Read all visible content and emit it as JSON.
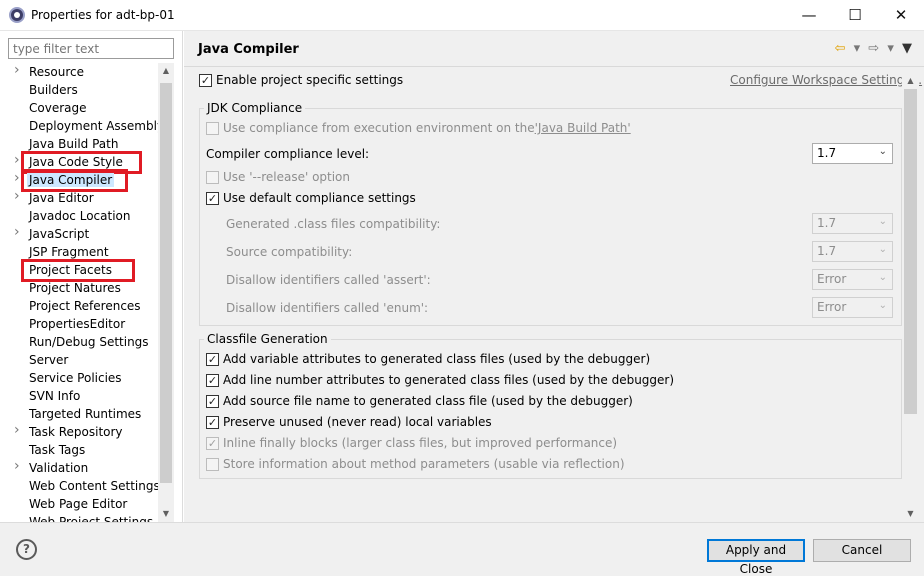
{
  "window": {
    "title": "Properties for adt-bp-01",
    "minimize_icon": "minimize-icon",
    "maximize_icon": "maximize-icon",
    "close_icon": "close-icon"
  },
  "filter": {
    "placeholder": "type filter text"
  },
  "tree": {
    "items": [
      {
        "label": "Resource",
        "expandable": true
      },
      {
        "label": "Builders",
        "expandable": false
      },
      {
        "label": "Coverage",
        "expandable": false
      },
      {
        "label": "Deployment Assembly",
        "expandable": false
      },
      {
        "label": "Java Build Path",
        "expandable": false
      },
      {
        "label": "Java Code Style",
        "expandable": true,
        "highlighted": true
      },
      {
        "label": "Java Compiler",
        "expandable": true,
        "highlighted": true,
        "selected": true
      },
      {
        "label": "Java Editor",
        "expandable": true
      },
      {
        "label": "Javadoc Location",
        "expandable": false
      },
      {
        "label": "JavaScript",
        "expandable": true
      },
      {
        "label": "JSP Fragment",
        "expandable": false
      },
      {
        "label": "Project Facets",
        "expandable": false,
        "highlighted": true
      },
      {
        "label": "Project Natures",
        "expandable": false
      },
      {
        "label": "Project References",
        "expandable": false
      },
      {
        "label": "PropertiesEditor",
        "expandable": false
      },
      {
        "label": "Run/Debug Settings",
        "expandable": false
      },
      {
        "label": "Server",
        "expandable": false
      },
      {
        "label": "Service Policies",
        "expandable": false
      },
      {
        "label": "SVN Info",
        "expandable": false
      },
      {
        "label": "Targeted Runtimes",
        "expandable": false
      },
      {
        "label": "Task Repository",
        "expandable": true
      },
      {
        "label": "Task Tags",
        "expandable": false
      },
      {
        "label": "Validation",
        "expandable": true
      },
      {
        "label": "Web Content Settings",
        "expandable": false
      },
      {
        "label": "Web Page Editor",
        "expandable": false
      },
      {
        "label": "Web Project Settings",
        "expandable": false
      }
    ],
    "highlight_color": "#e01b24"
  },
  "page": {
    "title": "Java Compiler",
    "enable_specific": {
      "label": "Enable project specific settings",
      "checked": true
    },
    "configure_link": "Configure Workspace Settings...",
    "jdk": {
      "title": "JDK Compliance",
      "use_execution_env": {
        "label": "Use compliance from execution environment on the ",
        "link": "'Java Build Path'",
        "checked": false,
        "enabled": false
      },
      "compliance_level": {
        "label": "Compiler compliance level:",
        "value": "1.7"
      },
      "use_release": {
        "label": "Use '--release' option",
        "checked": false,
        "enabled": false
      },
      "use_default": {
        "label": "Use default compliance settings",
        "checked": true,
        "enabled": true
      },
      "settings": [
        {
          "label": "Generated .class files compatibility:",
          "value": "1.7"
        },
        {
          "label": "Source compatibility:",
          "value": "1.7"
        },
        {
          "label": "Disallow identifiers called 'assert':",
          "value": "Error"
        },
        {
          "label": "Disallow identifiers called 'enum':",
          "value": "Error"
        }
      ]
    },
    "classfile": {
      "title": "Classfile Generation",
      "options": [
        {
          "label": "Add variable attributes to generated class files (used by the debugger)",
          "checked": true,
          "enabled": true
        },
        {
          "label": "Add line number attributes to generated class files (used by the debugger)",
          "checked": true,
          "enabled": true
        },
        {
          "label": "Add source file name to generated class file (used by the debugger)",
          "checked": true,
          "enabled": true
        },
        {
          "label": "Preserve unused (never read) local variables",
          "checked": true,
          "enabled": true
        },
        {
          "label": "Inline finally blocks (larger class files, but improved performance)",
          "checked": true,
          "enabled": false
        },
        {
          "label": "Store information about method parameters (usable via reflection)",
          "checked": false,
          "enabled": false
        }
      ]
    }
  },
  "footer": {
    "help_label": "?",
    "apply_close": "Apply and Close",
    "cancel": "Cancel"
  }
}
